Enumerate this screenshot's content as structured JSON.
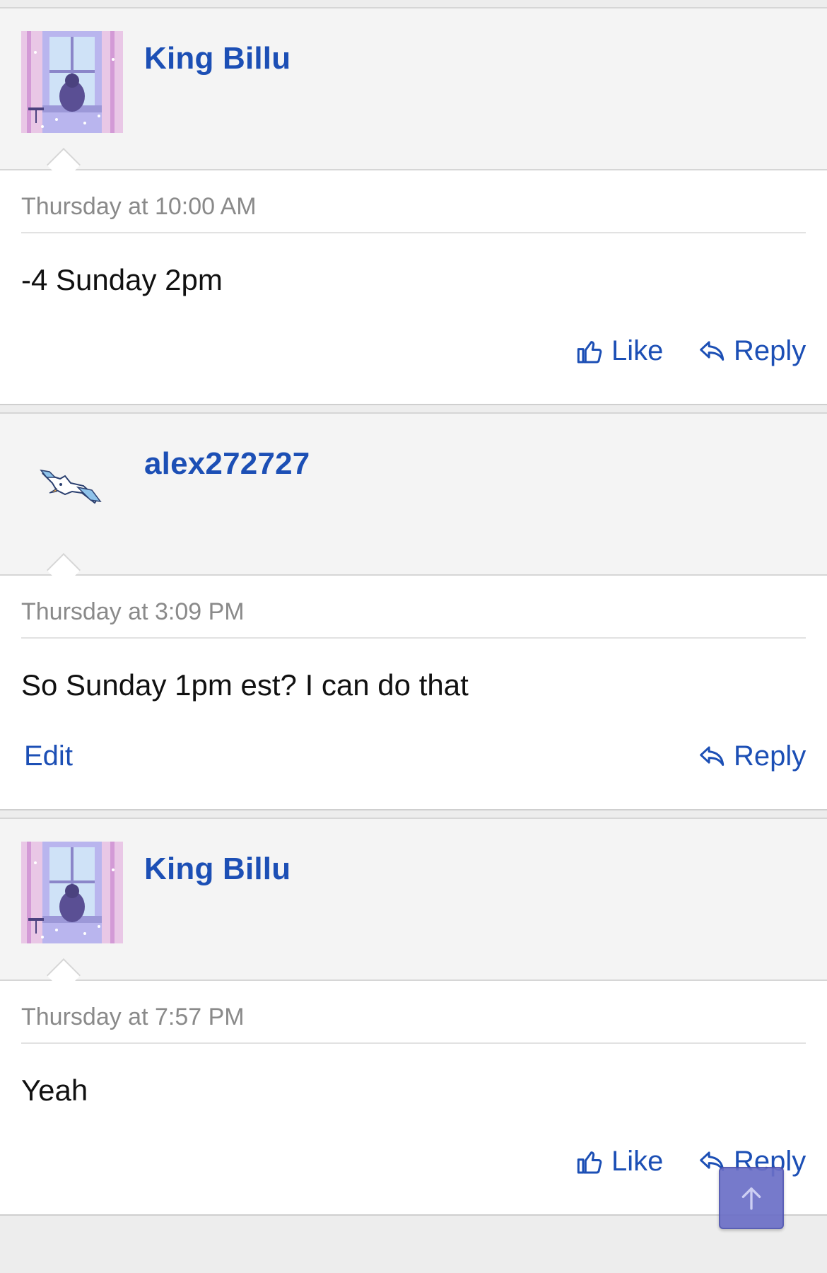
{
  "posts": [
    {
      "author": "King Billu",
      "avatar_icon": "anime-window-avatar",
      "timestamp": "Thursday at 10:00 AM",
      "message": "-4 Sunday 2pm",
      "like_label": "Like",
      "reply_label": "Reply"
    },
    {
      "author": "alex272727",
      "avatar_icon": "bird-avatar",
      "timestamp": "Thursday at 3:09 PM",
      "message": "So Sunday 1pm est? I can do that",
      "edit_label": "Edit",
      "reply_label": "Reply"
    },
    {
      "author": "King Billu",
      "avatar_icon": "anime-window-avatar",
      "timestamp": "Thursday at 7:57 PM",
      "message": "Yeah",
      "like_label": "Like",
      "reply_label": "Reply"
    }
  ],
  "scroll_top_icon": "arrow-up-icon",
  "colors": {
    "link": "#1c4fb5",
    "header_bg": "#f4f4f4",
    "scroll_button": "#6b6fc7"
  }
}
